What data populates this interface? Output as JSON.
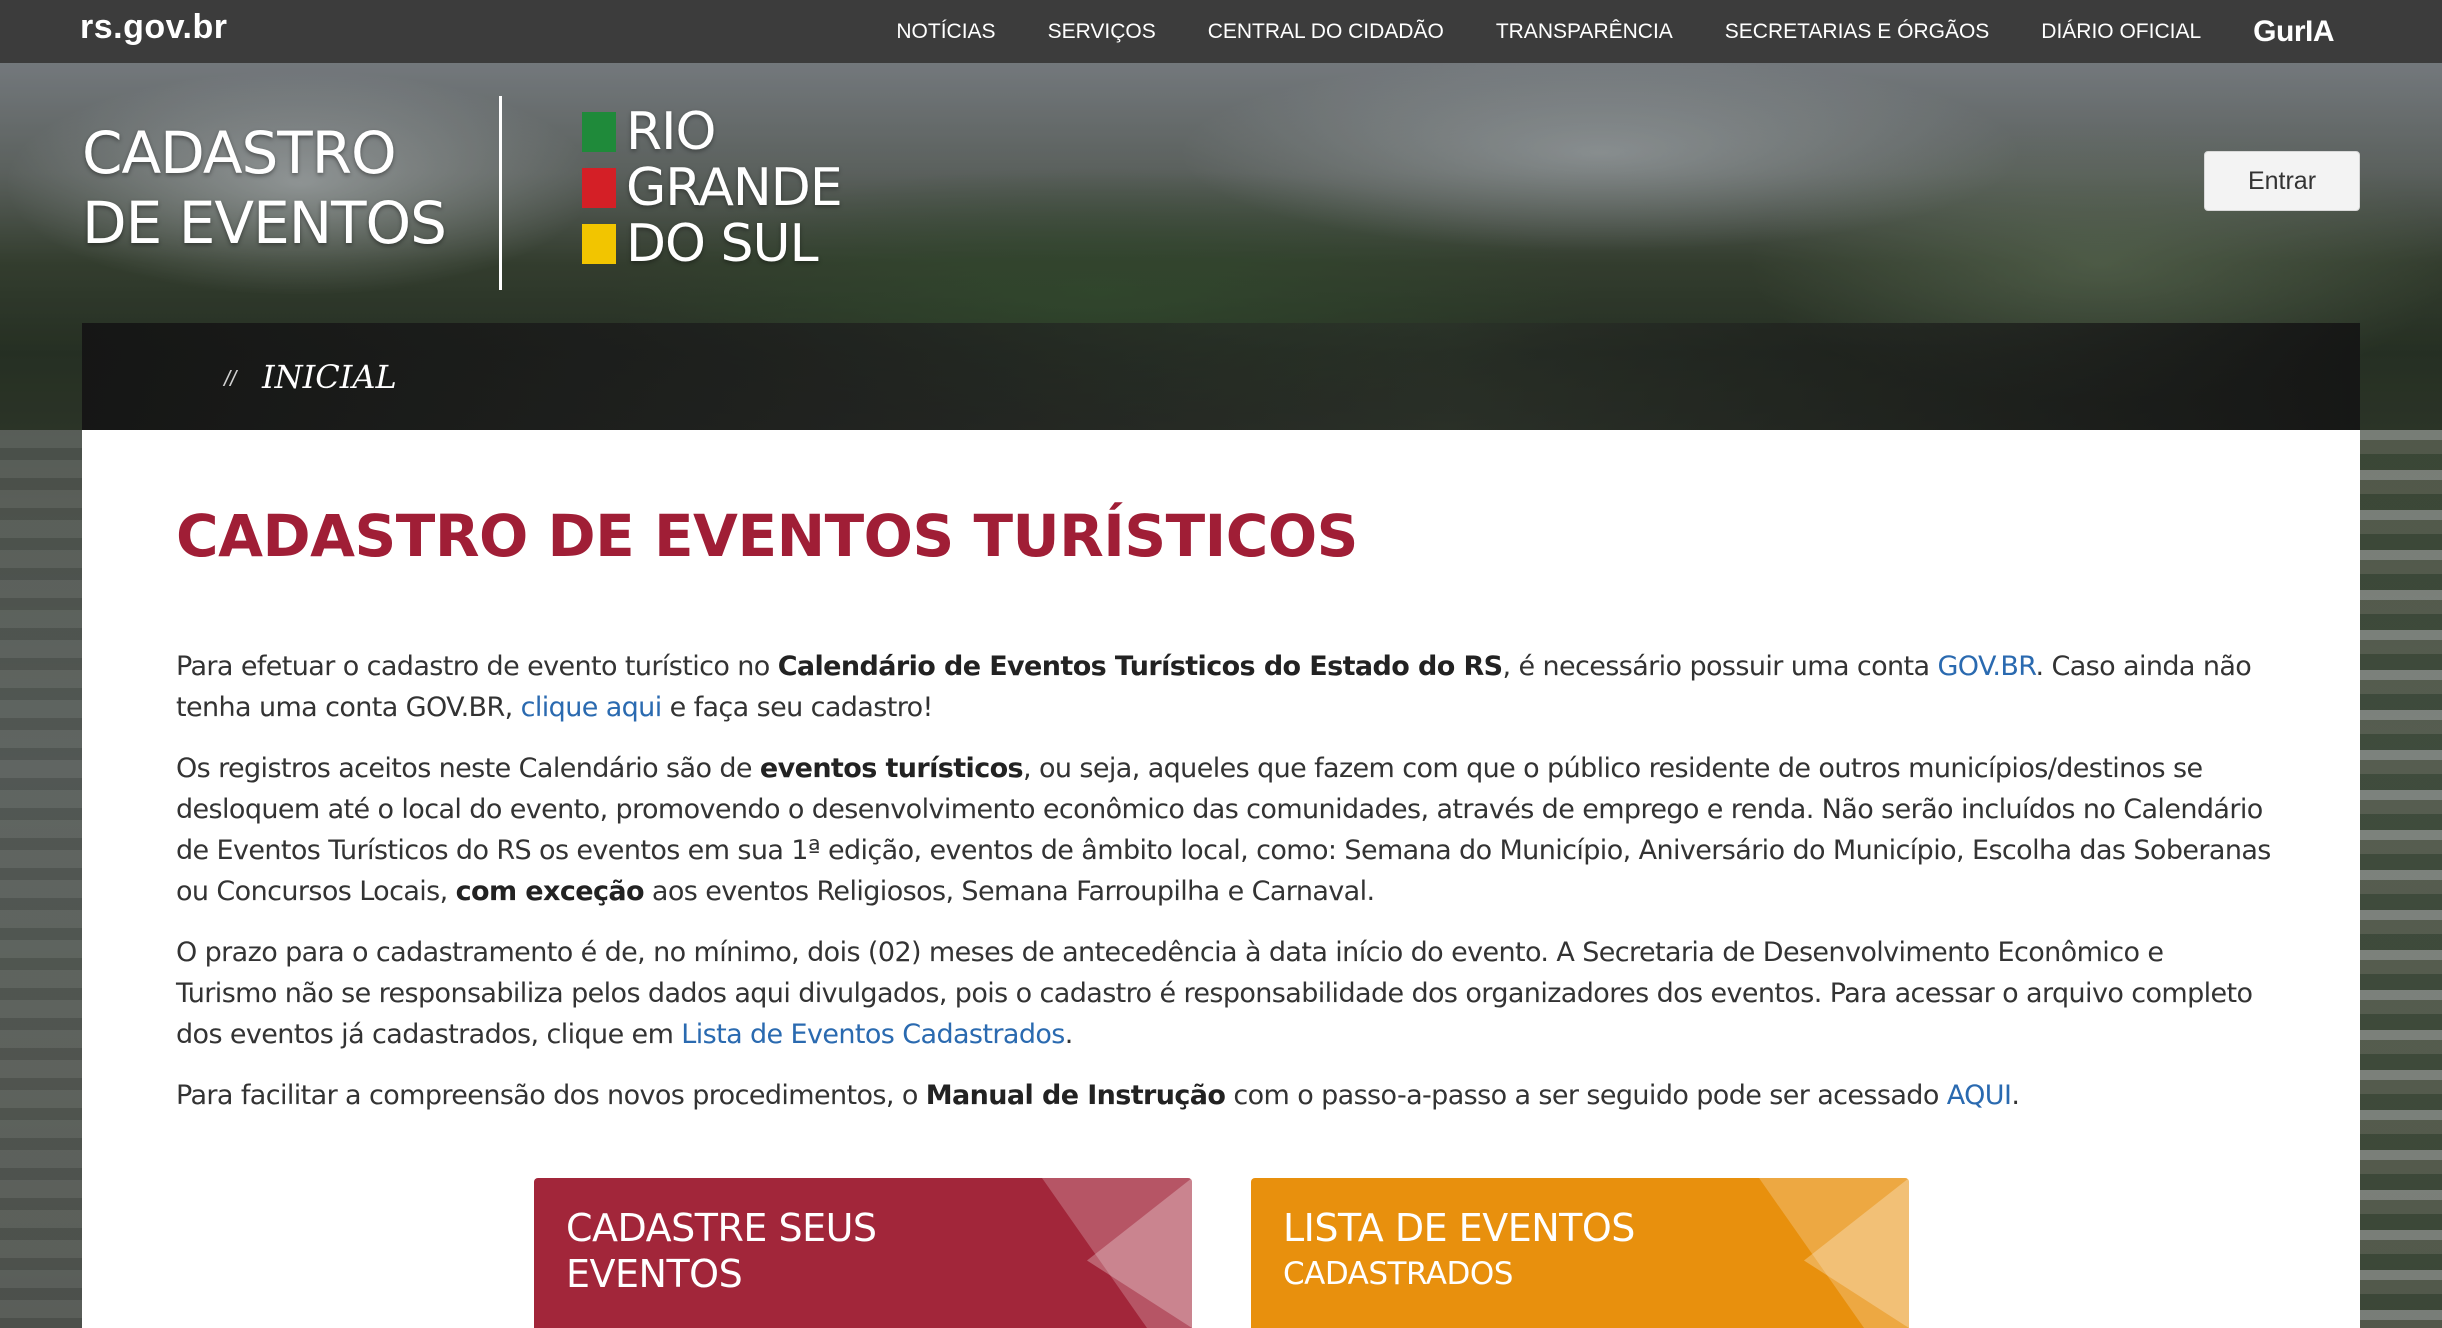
{
  "topbar": {
    "brand": "rs.gov.br",
    "nav": [
      "NOTÍCIAS",
      "SERVIÇOS",
      "CENTRAL DO CIDADÃO",
      "TRANSPARÊNCIA",
      "SECRETARIAS E ÓRGÃOS",
      "DIÁRIO OFICIAL"
    ],
    "guria": "GurIA"
  },
  "header": {
    "title_line1": "CADASTRO",
    "title_line2": "DE EVENTOS",
    "rs_logo": {
      "line1": "RIO",
      "line2": "GRANDE",
      "line3": "DO SUL",
      "colors": [
        "#1f8a3a",
        "#d41f26",
        "#f2c500"
      ]
    },
    "login_label": "Entrar"
  },
  "breadcrumb": {
    "separator": "//",
    "label": "INICIAL"
  },
  "main": {
    "title": "CADASTRO DE EVENTOS TURÍSTICOS",
    "p1": {
      "t1": "Para efetuar o cadastro de evento turístico no ",
      "b1": "Calendário de Eventos Turísticos do Estado do RS",
      "t2": ", é necessário possuir uma conta ",
      "link1": "GOV.BR",
      "t3": ". Caso ainda não tenha uma conta GOV.BR, ",
      "link2": "clique aqui",
      "t4": " e faça seu cadastro!"
    },
    "p2": {
      "t1": "Os registros aceitos neste Calendário são de ",
      "b1": "eventos turísticos",
      "t2": ", ou seja, aqueles que fazem com que o público residente de outros municípios/destinos se desloquem até o local do evento, promovendo o desenvolvimento econômico das comunidades, através de emprego e renda. Não serão incluídos no Calendário de Eventos Turísticos do RS os eventos em sua 1ª edição, eventos de âmbito local, como: Semana do Município, Aniversário do Município, Escolha das Soberanas ou Concursos Locais, ",
      "b2": "com exceção",
      "t3": " aos eventos Religiosos, Semana Farroupilha e Carnaval."
    },
    "p3": {
      "t1": "O prazo para o cadastramento é de, no mínimo, dois (02) meses de antecedência à data início do evento. A Secretaria de Desenvolvimento Econômico e Turismo não se responsabiliza pelos dados aqui divulgados, pois o cadastro é responsabilidade dos organizadores dos eventos. Para acessar o arquivo completo dos eventos já cadastrados, clique em ",
      "link1": "Lista de Eventos Cadastrados",
      "t2": "."
    },
    "p4": {
      "t1": "Para facilitar a compreensão dos novos procedimentos, o ",
      "b1": "Manual de Instrução",
      "t2": " com o passo-a-passo a ser seguido pode ser acessado ",
      "link1": "AQUI",
      "t3": "."
    },
    "cards": [
      {
        "line1": "CADASTRE SEUS",
        "line2": "EVENTOS",
        "color": "#a2263a"
      },
      {
        "line1": "LISTA DE EVENTOS",
        "line2": "CADASTRADOS",
        "color": "#e8900d"
      }
    ]
  }
}
